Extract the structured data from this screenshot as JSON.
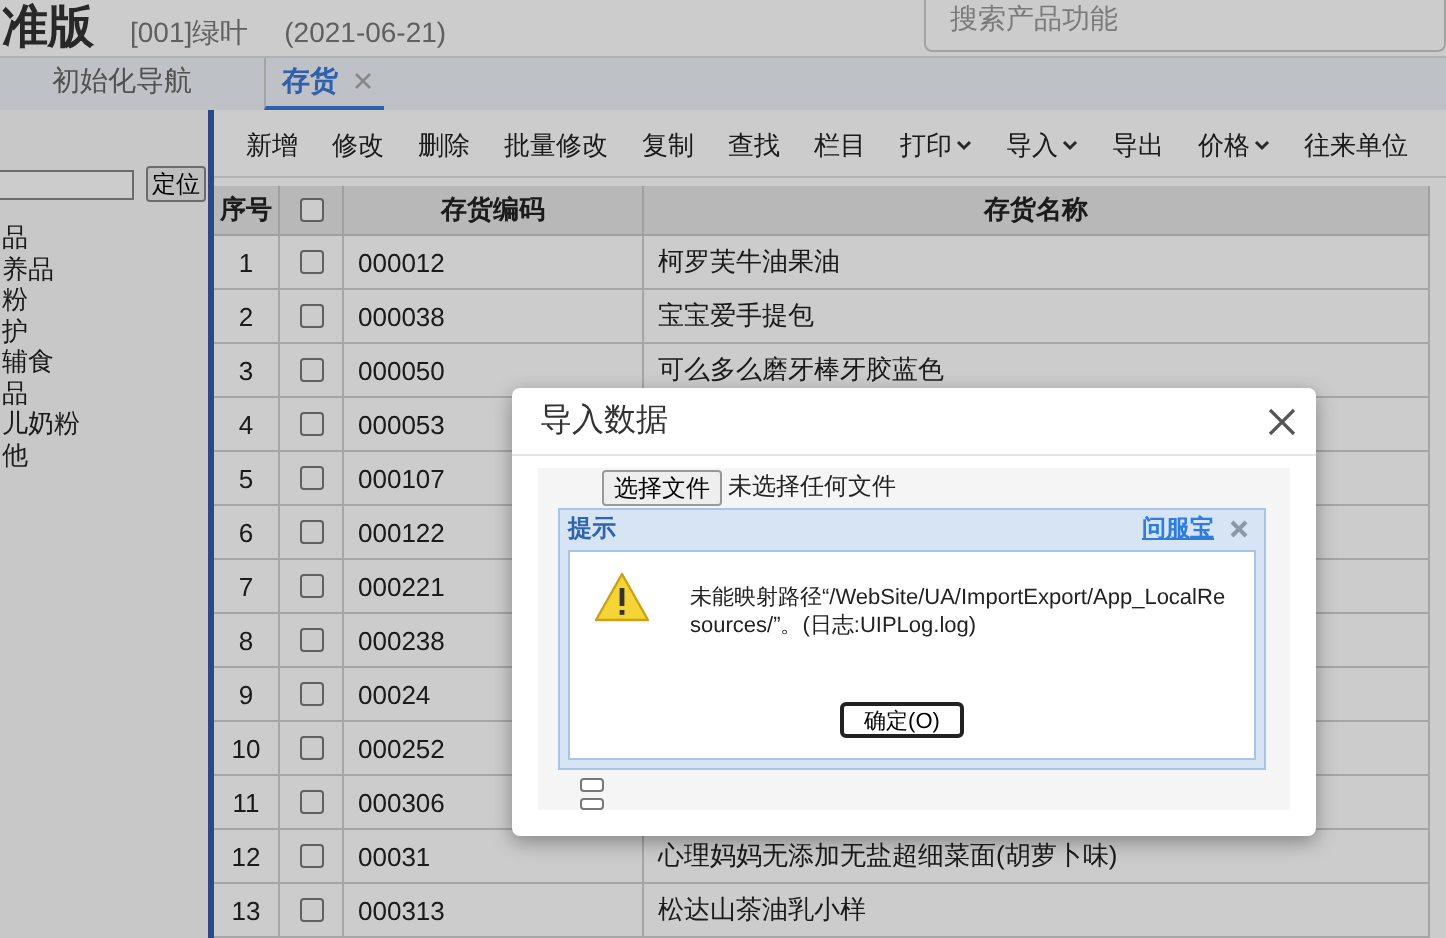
{
  "header": {
    "title": "准版",
    "account": "[001]绿叶",
    "date": "(2021-06-21)",
    "search_placeholder": "搜索产品功能"
  },
  "tabs": [
    {
      "label": "初始化导航",
      "selected": false,
      "closable": false
    },
    {
      "label": "存货",
      "selected": true,
      "closable": true
    }
  ],
  "sidebar": {
    "locate_button": "定位",
    "items": [
      "品",
      "养品",
      "粉",
      "护",
      "辅食",
      "品",
      "儿奶粉",
      "他"
    ]
  },
  "toolbar": [
    {
      "label": "新增",
      "dropdown": false
    },
    {
      "label": "修改",
      "dropdown": false
    },
    {
      "label": "删除",
      "dropdown": false
    },
    {
      "label": "批量修改",
      "dropdown": false
    },
    {
      "label": "复制",
      "dropdown": false
    },
    {
      "label": "查找",
      "dropdown": false
    },
    {
      "label": "栏目",
      "dropdown": false
    },
    {
      "label": "打印",
      "dropdown": true
    },
    {
      "label": "导入",
      "dropdown": true
    },
    {
      "label": "导出",
      "dropdown": false
    },
    {
      "label": "价格",
      "dropdown": true
    },
    {
      "label": "往来单位",
      "dropdown": false
    }
  ],
  "table": {
    "columns": [
      "序号",
      "存货编码",
      "存货名称"
    ],
    "all_checked": false,
    "rows": [
      {
        "index": "1",
        "checked": false,
        "code": "000012",
        "name": "柯罗芙牛油果油"
      },
      {
        "index": "2",
        "checked": false,
        "code": "000038",
        "name": "宝宝爱手提包"
      },
      {
        "index": "3",
        "checked": false,
        "code": "000050",
        "name": "可么多么磨牙棒牙胶蓝色"
      },
      {
        "index": "4",
        "checked": false,
        "code": "000053"
      },
      {
        "index": "5",
        "checked": false,
        "code": "000107"
      },
      {
        "index": "6",
        "checked": false,
        "code": "000122"
      },
      {
        "index": "7",
        "checked": false,
        "code": "000221"
      },
      {
        "index": "8",
        "checked": false,
        "code": "000238"
      },
      {
        "index": "9",
        "checked": false,
        "code": "00024"
      },
      {
        "index": "10",
        "checked": false,
        "code": "000252"
      },
      {
        "index": "11",
        "checked": false,
        "code": "000306"
      },
      {
        "index": "12",
        "checked": false,
        "code": "00031",
        "name": "心理妈妈无添加无盐超细菜面(胡萝卜味)"
      },
      {
        "index": "13",
        "checked": false,
        "code": "000313",
        "name": "松达山茶油乳小样"
      }
    ]
  },
  "dialog": {
    "title": "导入数据",
    "file_button": "选择文件",
    "file_status": "未选择任何文件",
    "alert": {
      "title": "提示",
      "help_link": "问服宝",
      "message": "未能映射路径“/WebSite/UA/ImportExport/App_LocalResources/”。(日志:UIPLog.log)",
      "ok_button": "确定(O)"
    },
    "checkboxes": [
      {
        "checked": false
      },
      {
        "checked": false
      }
    ]
  }
}
